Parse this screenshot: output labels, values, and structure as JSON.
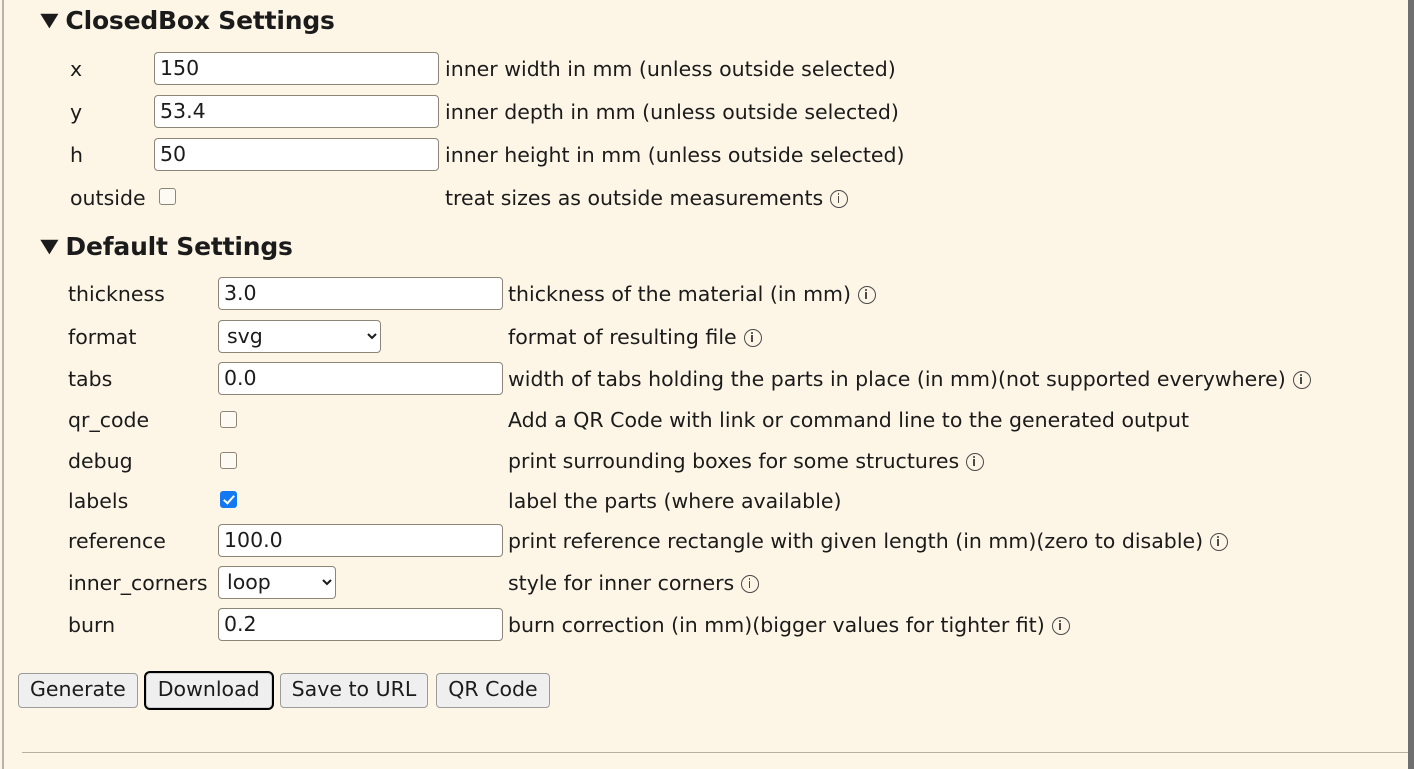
{
  "page": {
    "background_color": "#fdf6e7",
    "text_color": "#1b1b1b",
    "accent_checkbox_color": "#1478f0"
  },
  "sections": [
    {
      "title": "ClosedBox Settings",
      "toggle_icon": "triangle-down-icon",
      "expanded": true
    },
    {
      "title": "Default Settings",
      "toggle_icon": "triangle-down-icon",
      "expanded": true
    }
  ],
  "closedbox": {
    "title": "ClosedBox Settings",
    "fields": [
      {
        "label": "x",
        "type": "text",
        "value": "150",
        "description": "inner width in mm (unless outside selected)",
        "info": false
      },
      {
        "label": "y",
        "type": "text",
        "value": "53.4",
        "description": "inner depth in mm (unless outside selected)",
        "info": false
      },
      {
        "label": "h",
        "type": "text",
        "value": "50",
        "description": "inner height in mm (unless outside selected)",
        "info": false
      },
      {
        "label": "outside",
        "type": "checkbox",
        "checked": false,
        "description": "treat sizes as outside measurements",
        "info": true
      }
    ]
  },
  "defaults": {
    "title": "Default Settings",
    "fields": [
      {
        "label": "thickness",
        "type": "text",
        "value": "3.0",
        "description": "thickness of the material (in mm)",
        "info": true
      },
      {
        "label": "format",
        "type": "select",
        "value": "svg",
        "options": [
          "svg"
        ],
        "description": "format of resulting file",
        "info": true
      },
      {
        "label": "tabs",
        "type": "text",
        "value": "0.0",
        "description": "width of tabs holding the parts in place (in mm)(not supported everywhere)",
        "info": true
      },
      {
        "label": "qr_code",
        "type": "checkbox",
        "checked": false,
        "description": "Add a QR Code with link or command line to the generated output",
        "info": false
      },
      {
        "label": "debug",
        "type": "checkbox",
        "checked": false,
        "description": "print surrounding boxes for some structures",
        "info": true
      },
      {
        "label": "labels",
        "type": "checkbox",
        "checked": true,
        "description": "label the parts (where available)",
        "info": false
      },
      {
        "label": "reference",
        "type": "text",
        "value": "100.0",
        "description": "print reference rectangle with given length (in mm)(zero to disable)",
        "info": true
      },
      {
        "label": "inner_corners",
        "type": "select",
        "value": "loop",
        "options": [
          "loop"
        ],
        "description": "style for inner corners",
        "info": true
      },
      {
        "label": "burn",
        "type": "text",
        "value": "0.2",
        "description": "burn correction (in mm)(bigger values for tighter fit)",
        "info": true
      }
    ]
  },
  "buttons": [
    {
      "label": "Generate",
      "focused": false
    },
    {
      "label": "Download",
      "focused": true
    },
    {
      "label": "Save to URL",
      "focused": false
    },
    {
      "label": "QR Code",
      "focused": false
    }
  ]
}
